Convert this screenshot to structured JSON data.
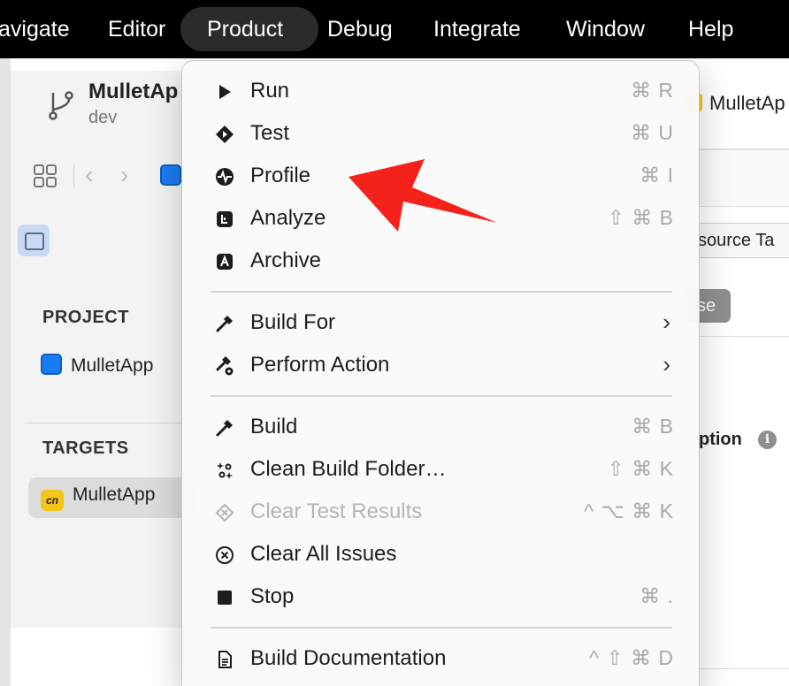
{
  "menubar": {
    "items": [
      {
        "label": "avigate"
      },
      {
        "label": "Editor"
      },
      {
        "label": "Product"
      },
      {
        "label": "Debug"
      },
      {
        "label": "Integrate"
      },
      {
        "label": "Window"
      },
      {
        "label": "Help"
      }
    ]
  },
  "project": {
    "title": "MulletAp",
    "branch": "dev",
    "right_chip": "MulletAp"
  },
  "sidebar": {
    "project_header": "PROJECT",
    "project_item": "MulletApp",
    "targets_header": "TARGETS",
    "target_item": "MulletApp",
    "target_icon_text": "cn"
  },
  "editor": {
    "right_tab": "source Ta",
    "right_button": "se",
    "right_heading": "ption",
    "info_glyph": "i"
  },
  "menu": {
    "items": [
      {
        "label": "Run",
        "shortcut": "⌘ R",
        "icon": "play-icon"
      },
      {
        "label": "Test",
        "shortcut": "⌘ U",
        "icon": "test-diamond-icon"
      },
      {
        "label": "Profile",
        "shortcut": "⌘ I",
        "icon": "profile-waveform-icon"
      },
      {
        "label": "Analyze",
        "shortcut": "⇧ ⌘ B",
        "icon": "analyze-icon"
      },
      {
        "label": "Archive",
        "shortcut": "",
        "icon": "archive-icon"
      },
      {
        "label": "Build For",
        "shortcut": "›",
        "icon": "hammer-icon"
      },
      {
        "label": "Perform Action",
        "shortcut": "›",
        "icon": "hammer-action-icon"
      },
      {
        "label": "Build",
        "shortcut": "⌘ B",
        "icon": "hammer-icon"
      },
      {
        "label": "Clean Build Folder…",
        "shortcut": "⇧ ⌘ K",
        "icon": "clean-sparkle-icon"
      },
      {
        "label": "Clear Test Results",
        "shortcut": "^ ⌥ ⌘ K",
        "icon": "clear-test-icon",
        "disabled": true
      },
      {
        "label": "Clear All Issues",
        "shortcut": "",
        "icon": "clear-issues-icon"
      },
      {
        "label": "Stop",
        "shortcut": "⌘ .",
        "icon": "stop-icon"
      },
      {
        "label": "Build Documentation",
        "shortcut": "^ ⇧ ⌘ D",
        "icon": "document-icon"
      }
    ]
  },
  "colors": {
    "menubar_bg": "#000000",
    "active_menu_bg": "#2b2b2d",
    "annotation_arrow": "#f5221b",
    "accent_blue": "#1a7cf5",
    "target_icon_yellow": "#f5c518"
  }
}
